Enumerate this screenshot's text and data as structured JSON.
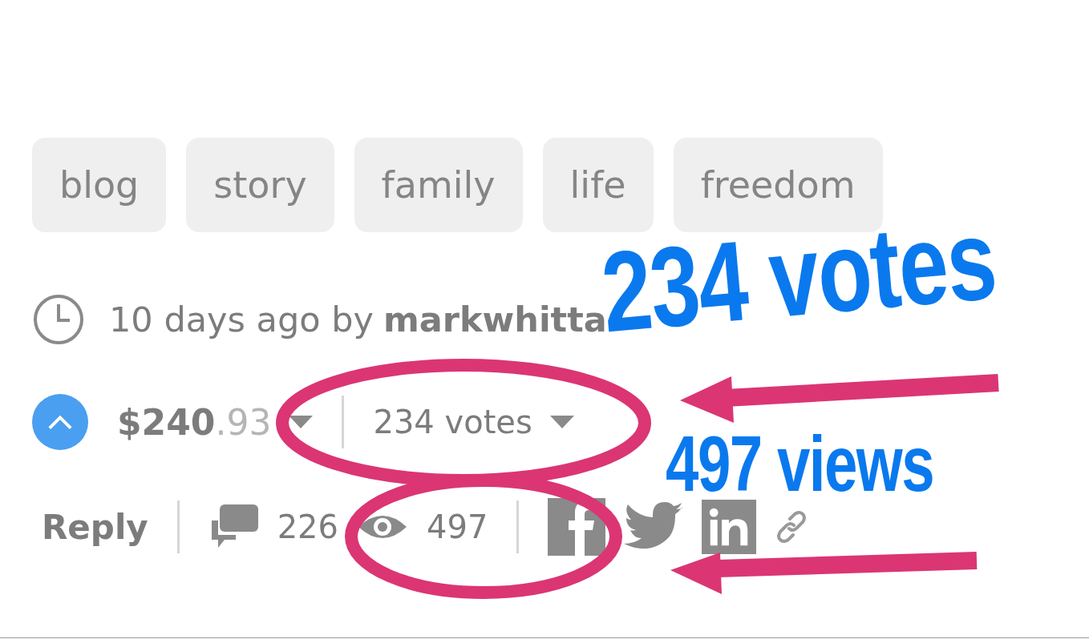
{
  "tags": [
    {
      "label": "blog"
    },
    {
      "label": "story"
    },
    {
      "label": "family"
    },
    {
      "label": "life"
    },
    {
      "label": "freedom"
    }
  ],
  "meta": {
    "time": "10 days ago by",
    "author": "markwhitta"
  },
  "payout": {
    "whole": "$240",
    "cents": ".93"
  },
  "votes": "234 votes",
  "actions": {
    "reply": "Reply",
    "comments": "226",
    "views": "497"
  },
  "annotations": [
    {
      "kind": "callout",
      "text": "234 votes"
    },
    {
      "kind": "callout",
      "text": "497 views"
    }
  ]
}
